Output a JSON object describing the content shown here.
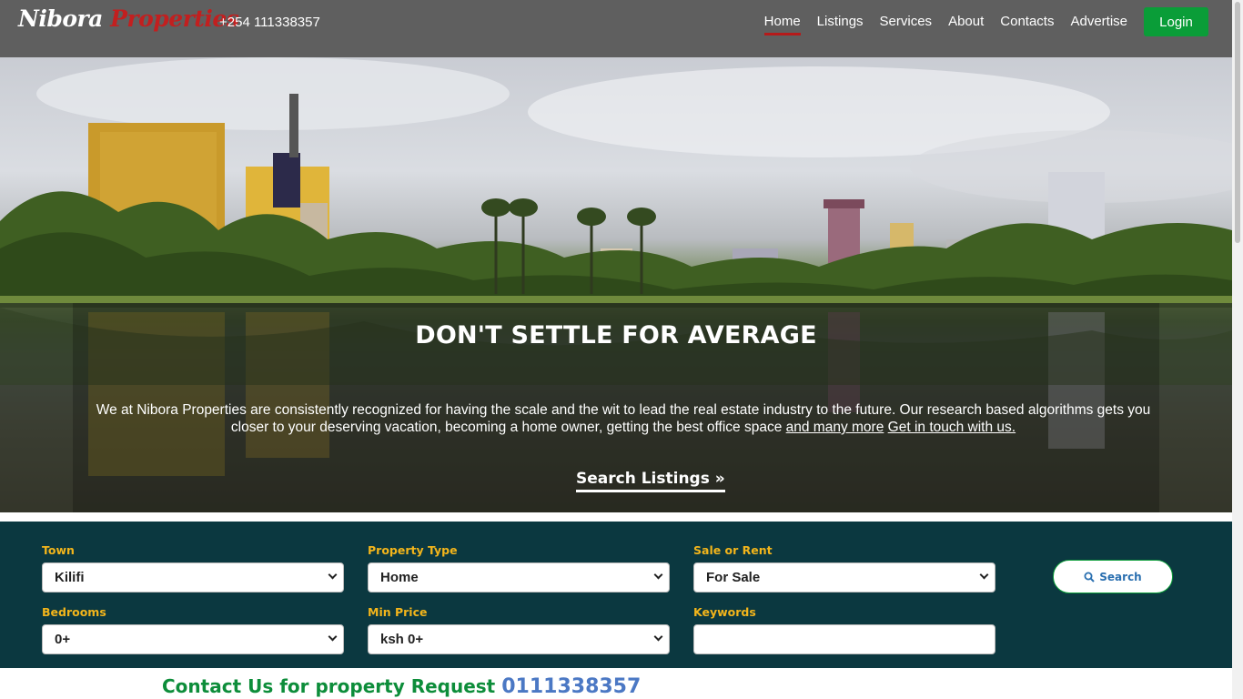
{
  "header": {
    "logo_part1": "Nibora",
    "logo_part2": "Properties",
    "phone": "+254 111338357",
    "nav": [
      "Home",
      "Listings",
      "Services",
      "About",
      "Contacts",
      "Advertise"
    ],
    "active_nav": "Home",
    "login_label": "Login"
  },
  "hero": {
    "title": "DON'T SETTLE FOR AVERAGE",
    "text": "We at Nibora Properties are consistently recognized for having the scale and the wit to lead the real estate industry to the future. Our research based algorithms gets you closer to your deserving vacation, becoming a home owner, getting the best office space",
    "link_more": "and many more",
    "link_contact": "Get in touch with us.",
    "cta": "Search Listings »"
  },
  "search": {
    "town": {
      "label": "Town",
      "value": "Kilifi"
    },
    "property_type": {
      "label": "Property Type",
      "value": "Home"
    },
    "sale_or_rent": {
      "label": "Sale or Rent",
      "value": "For Sale"
    },
    "bedrooms": {
      "label": "Bedrooms",
      "value": "0+"
    },
    "min_price": {
      "label": "Min Price",
      "value": "ksh 0+"
    },
    "keywords": {
      "label": "Keywords",
      "value": ""
    },
    "button_label": "Search",
    "button_icon": "search-icon"
  },
  "contact": {
    "text": "Contact Us for property Request",
    "number": "0111338357"
  },
  "colors": {
    "header_bg": "#5f5f5f",
    "nav_active_underline": "#b61a1a",
    "login_bg": "#0a9d38",
    "search_panel_bg": "#0b3840",
    "search_label": "#f3b51b",
    "contact_text": "#0d8d3a",
    "contact_number": "#4b78c4"
  }
}
